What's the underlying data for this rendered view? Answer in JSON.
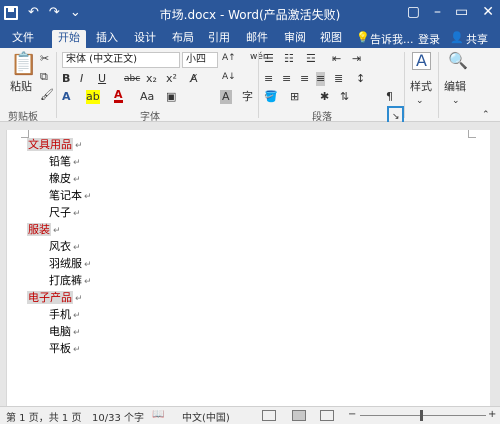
{
  "window": {
    "title": "市场.docx - Word(产品激活失败)",
    "controls": [
      "▢",
      "–",
      "▭",
      "✕"
    ]
  },
  "qat": {
    "undo": "↶",
    "redo": "↷",
    "more": "⌄"
  },
  "tabs": [
    "文件",
    "开始",
    "插入",
    "设计",
    "布局",
    "引用",
    "邮件",
    "审阅",
    "视图"
  ],
  "active_tab": "开始",
  "tell_me": "告诉我...",
  "signin": "登录",
  "share": "共享",
  "ribbon": {
    "clipboard": {
      "paste": "粘贴",
      "label": "剪贴板"
    },
    "font": {
      "font_name": "宋体 (中文正文)",
      "font_size": "小四",
      "wen_label": "wén",
      "label": "字体",
      "row2": [
        "B",
        "I",
        "U",
        "abc",
        "x₂",
        "x²"
      ],
      "aa": "Aa"
    },
    "paragraph": {
      "label": "段落"
    },
    "styles": {
      "label": "样式"
    },
    "editing": {
      "label": "编辑"
    }
  },
  "document": {
    "lines": [
      {
        "text": "文具用品",
        "heading": true
      },
      {
        "text": "铅笔",
        "heading": false
      },
      {
        "text": "橡皮",
        "heading": false
      },
      {
        "text": "笔记本",
        "heading": false
      },
      {
        "text": "尺子",
        "heading": false
      },
      {
        "text": "服装",
        "heading": true
      },
      {
        "text": "风衣",
        "heading": false
      },
      {
        "text": "羽绒服",
        "heading": false
      },
      {
        "text": "打底裤",
        "heading": false
      },
      {
        "text": "电子产品",
        "heading": true
      },
      {
        "text": "手机",
        "heading": false
      },
      {
        "text": "电脑",
        "heading": false
      },
      {
        "text": "平板",
        "heading": false
      }
    ],
    "pilcrow": "↵"
  },
  "status": {
    "page": "第 1 页，共 1 页",
    "words": "10/33 个字",
    "language": "中文(中国)",
    "zoom_minus": "−",
    "zoom_plus": "+"
  }
}
